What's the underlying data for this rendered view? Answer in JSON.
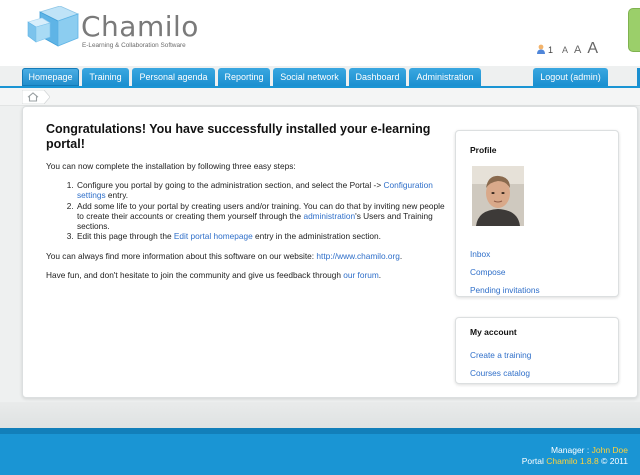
{
  "header": {
    "logo_word": "Chamilo",
    "logo_tagline": "E-Learning & Collaboration Software",
    "online_count": "1",
    "font_sizes": [
      "A",
      "A",
      "A"
    ]
  },
  "nav": {
    "tabs": [
      {
        "label": "Homepage",
        "active": true
      },
      {
        "label": "Training"
      },
      {
        "label": "Personal agenda"
      },
      {
        "label": "Reporting"
      },
      {
        "label": "Social network"
      },
      {
        "label": "Dashboard"
      },
      {
        "label": "Administration"
      }
    ],
    "logout_label": "Logout (admin)"
  },
  "main": {
    "title": "Congratulations! You have successfully installed your e-learning portal!",
    "intro": "You can now complete the installation by following three easy steps:",
    "step1_pre": "Configure you portal by going to the administration section, and select the Portal -> ",
    "step1_link": "Configuration settings",
    "step1_post": " entry.",
    "step2_pre": "Add some life to your portal by creating users and/or training. You can do that by inviting new people to create their accounts or creating them yourself through the ",
    "step2_link": "administration",
    "step2_post": "'s Users and Training sections.",
    "step3_pre": "Edit this page through the ",
    "step3_link": "Edit portal homepage",
    "step3_post": " entry in the administration section.",
    "info_pre": "You can always find more information about this software on our website: ",
    "info_link": "http://www.chamilo.org",
    "info_post": ".",
    "feedback_pre": "Have fun, and don't hesitate to join the community and give us feedback through ",
    "feedback_link": "our forum",
    "feedback_post": "."
  },
  "sidebar": {
    "profile_title": "Profile",
    "profile_links": [
      "Inbox",
      "Compose",
      "Pending invitations"
    ],
    "account_title": "My account",
    "account_links": [
      "Create a training",
      "Courses catalog"
    ]
  },
  "footer": {
    "manager_label": "Manager : ",
    "manager_name": "John Doe",
    "portal_label": "Portal ",
    "portal_version": "Chamilo 1.8.8",
    "copyright": " © 2011"
  },
  "colors": {
    "accent": "#1a95d4",
    "link": "#2f6fc9",
    "footer_highlight": "#ffd23a"
  }
}
